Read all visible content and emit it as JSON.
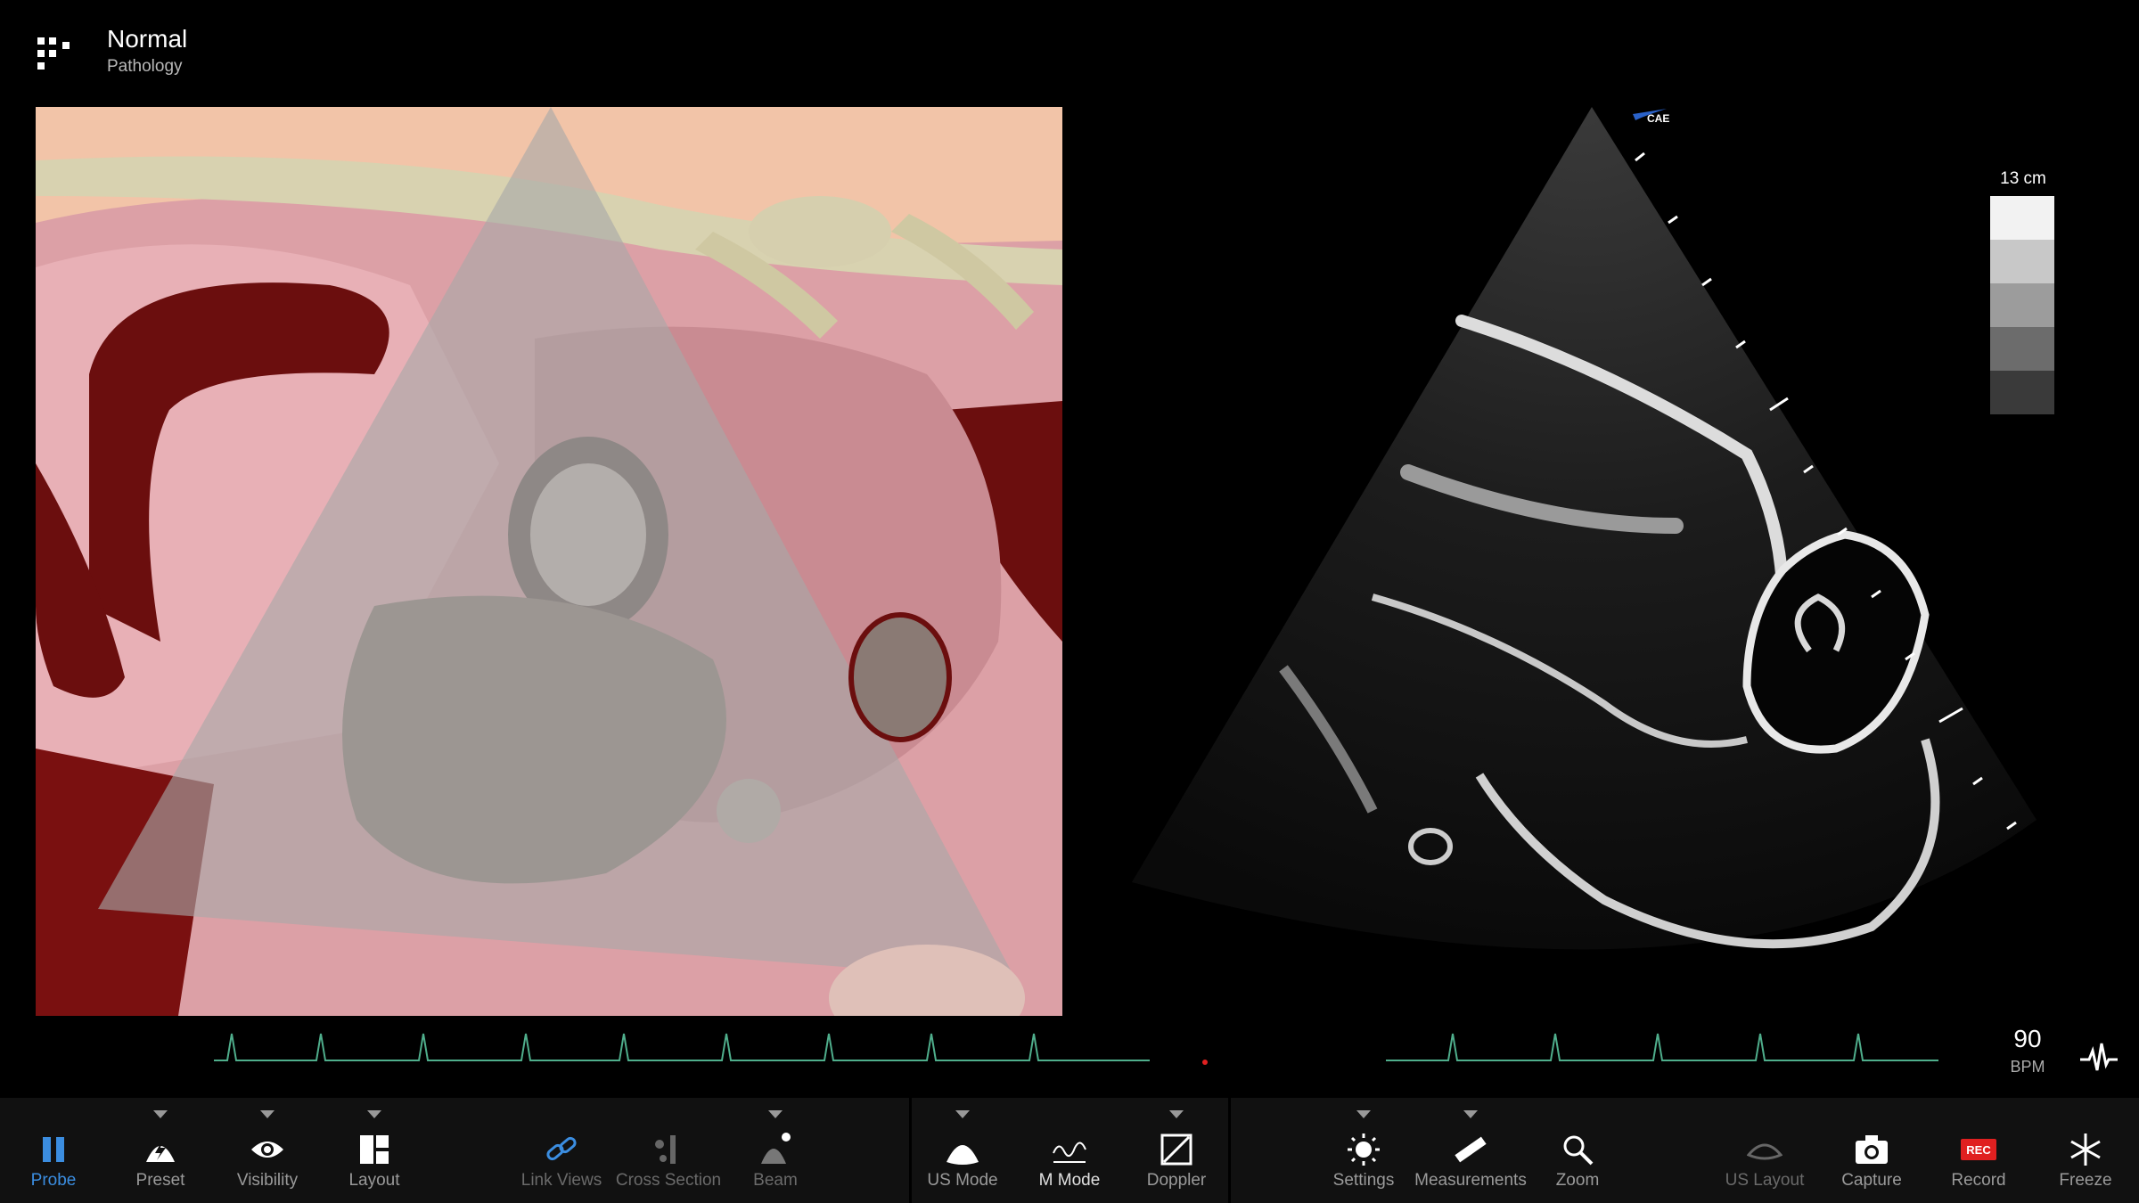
{
  "header": {
    "title": "Normal",
    "subtitle": "Pathology",
    "menu_icon": "grid-menu-icon"
  },
  "ultrasound": {
    "logo_text": "CAE",
    "depth_label": "13 cm",
    "gray_scale_colors": [
      "#f2f2f2",
      "#c8c8c8",
      "#9c9c9c",
      "#6c6c6c",
      "#3a3a3a"
    ]
  },
  "vitals": {
    "heart_rate": "90",
    "heart_rate_unit": "BPM"
  },
  "toolbar": {
    "probe": "Probe",
    "preset": "Preset",
    "visibility": "Visibility",
    "layout": "Layout",
    "link_views": "Link Views",
    "cross_section": "Cross Section",
    "beam": "Beam",
    "us_mode": "US Mode",
    "m_mode": "M Mode",
    "doppler": "Doppler",
    "settings": "Settings",
    "measurements": "Measurements",
    "zoom": "Zoom",
    "us_layout": "US Layout",
    "capture": "Capture",
    "record": "Record",
    "record_badge": "REC",
    "freeze": "Freeze"
  },
  "colors": {
    "active": "#3b8de0",
    "record": "#e02020",
    "ecg": "#4fae8c"
  }
}
